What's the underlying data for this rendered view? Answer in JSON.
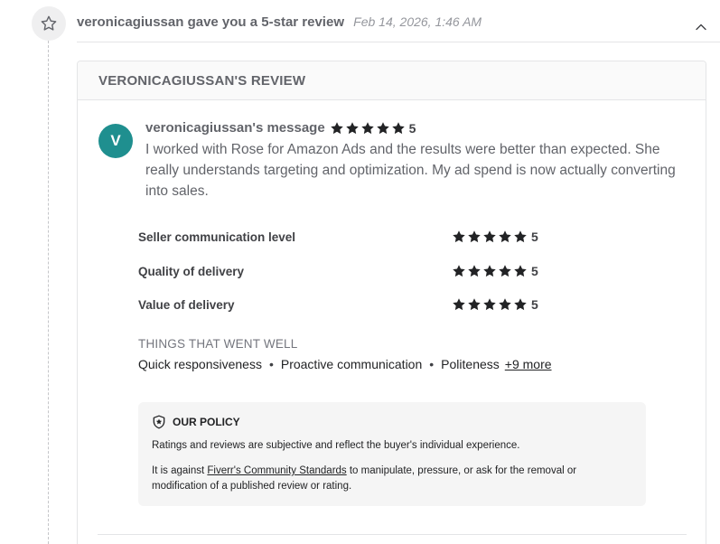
{
  "notification": {
    "actor": "veronicagiussan",
    "text": "gave you a 5-star review",
    "date": "Feb 14, 2026, 1:46 AM"
  },
  "review": {
    "heading": "VERONICAGIUSSAN'S REVIEW",
    "avatar_letter": "V",
    "avatar_color": "#1f8f8f",
    "message_title": "veronicagiussan's message",
    "overall_rating": 5,
    "overall_score_label": "5",
    "message": "I worked with Rose for Amazon Ads and the results were better than expected. She really understands targeting and optimization. My ad spend is now actually converting into sales.",
    "ratings": [
      {
        "label": "Seller communication level",
        "rating": 5,
        "score_label": "5"
      },
      {
        "label": "Quality of delivery",
        "rating": 5,
        "score_label": "5"
      },
      {
        "label": "Value of delivery",
        "rating": 5,
        "score_label": "5"
      }
    ],
    "went_well": {
      "title": "THINGS THAT WENT WELL",
      "items": [
        "Quick responsiveness",
        "Proactive communication",
        "Politeness"
      ],
      "more_label": "+9 more"
    }
  },
  "policy": {
    "title": "OUR POLICY",
    "line1": "Ratings and reviews are subjective and reflect the buyer's individual experience.",
    "line2_prefix": "It is against ",
    "line2_link": "Fiverr's Community Standards",
    "line2_suffix": " to manipulate, pressure, or ask for the removal or modification of a published review or rating."
  },
  "icons": {
    "header": "star-outline-icon",
    "collapse": "chevron-up-icon",
    "policy": "shield-star-icon",
    "rating": "star-icon"
  },
  "colors": {
    "star": "#222325",
    "avatar": "#1f8f8f"
  }
}
